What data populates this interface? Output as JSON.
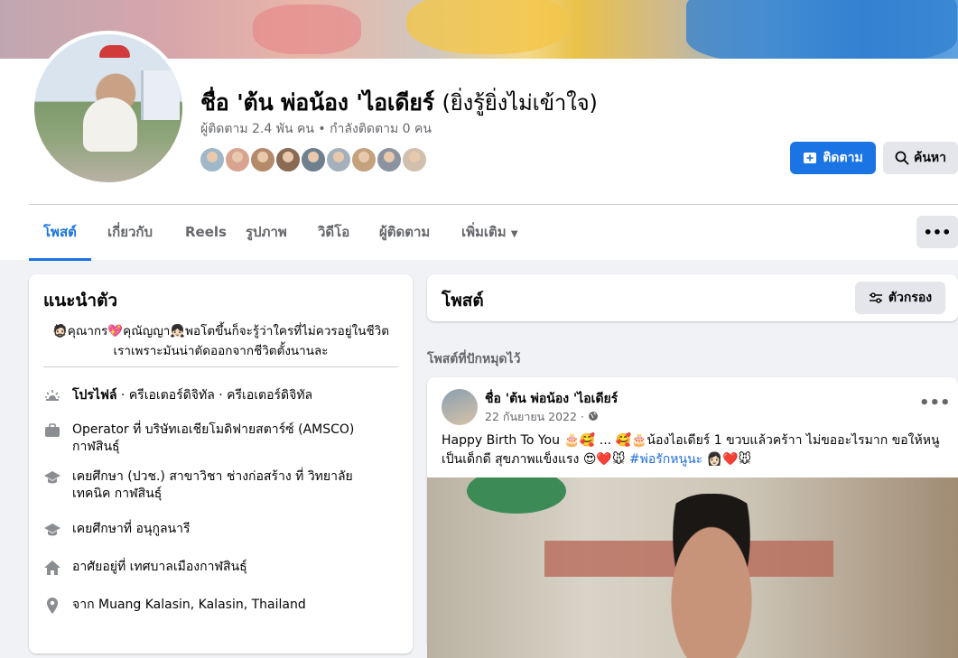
{
  "profile": {
    "name_main": "ชื่อ 'ต้น พ่อน้อง 'ไอเดียร์",
    "name_alt": "(ยิ่งรู้ยิ่งไม่เข้าใจ)",
    "stats": "ผู้ติดตาม 2.4 พัน คน • กำลังติดตาม 0 คน",
    "follow_button": "ติดตาม",
    "search_button": "ค้นหา",
    "friend_avatar_colors": [
      "#9fb7c8",
      "#d9a48f",
      "#b58a6b",
      "#8a6a52",
      "#6f7f8e",
      "#a4b1bd",
      "#c3a27d",
      "#8b93a0",
      "#d1c0ad"
    ]
  },
  "tabs": [
    {
      "label": "โพสต์",
      "active": true
    },
    {
      "label": "เกี่ยวกับ",
      "active": false
    },
    {
      "label": "Reels",
      "active": false
    },
    {
      "label": "รูปภาพ",
      "active": false
    },
    {
      "label": "วิดีโอ",
      "active": false
    },
    {
      "label": "ผู้ติดตาม",
      "active": false
    },
    {
      "label": "เพิ่มเติม",
      "active": false
    }
  ],
  "intro": {
    "title": "แนะนำตัว",
    "bio": "🧔🏻คุณากร💖คุณัญญา👧🏻พอโตขึ้นก็จะรู้ว่าใครที่ไม่ควรอยู่ในชีวิต เราเพราะมันน่าตัดออกจากชีวิตตั้งนานละ",
    "items": [
      {
        "icon": "category-icon",
        "bold": "โปรไฟล์",
        "text": " · ครีเอเตอร์ดิจิทัล · ครีเอเตอร์ดิจิทัล"
      },
      {
        "icon": "briefcase-icon",
        "bold": "",
        "text": "Operator ที่ บริษัทเอเชียโมดิฟายสตาร์ซ์ (AMSCO) กาฬสินธุ์"
      },
      {
        "icon": "graduation-cap-icon",
        "bold": "",
        "text": "เคยศึกษา (ปวช.) สาขาวิชา ช่างก่อสร้าง ที่ วิทยาลัยเทคนิค กาฬสินธุ์"
      },
      {
        "icon": "graduation-cap-icon",
        "bold": "",
        "text": "เคยศึกษาที่ อนุกูลนารี"
      },
      {
        "icon": "home-icon",
        "bold": "",
        "text": "อาศัยอยู่ที่ เทศบาลเมืองกาฬสินธุ์"
      },
      {
        "icon": "location-pin-icon",
        "bold": "",
        "text": "จาก Muang Kalasin, Kalasin, Thailand"
      }
    ]
  },
  "posts": {
    "title": "โพสต์",
    "filter_button": "ตัวกรอง",
    "pinned_label": "โพสต์ที่ปักหมุดไว้",
    "pinned_post": {
      "author": "ชื่อ 'ต้น พ่อน้อง 'ไอเดียร์",
      "date": "22 กันยายน 2022 ·",
      "text": "Happy Birth To You 🎂🥰 ... 🥰🎂น้องไอเดียร์ 1 ขวบแล้วคร้าา ไม่ขออะไรมาก ขอให้หนูเป็นเด็กดี สุขภาพแข็งแรง 😍❤️🐭",
      "hashtag": "#พ่อรักหนูนะ",
      "text_end": "👩🏻❤️🐭"
    }
  }
}
